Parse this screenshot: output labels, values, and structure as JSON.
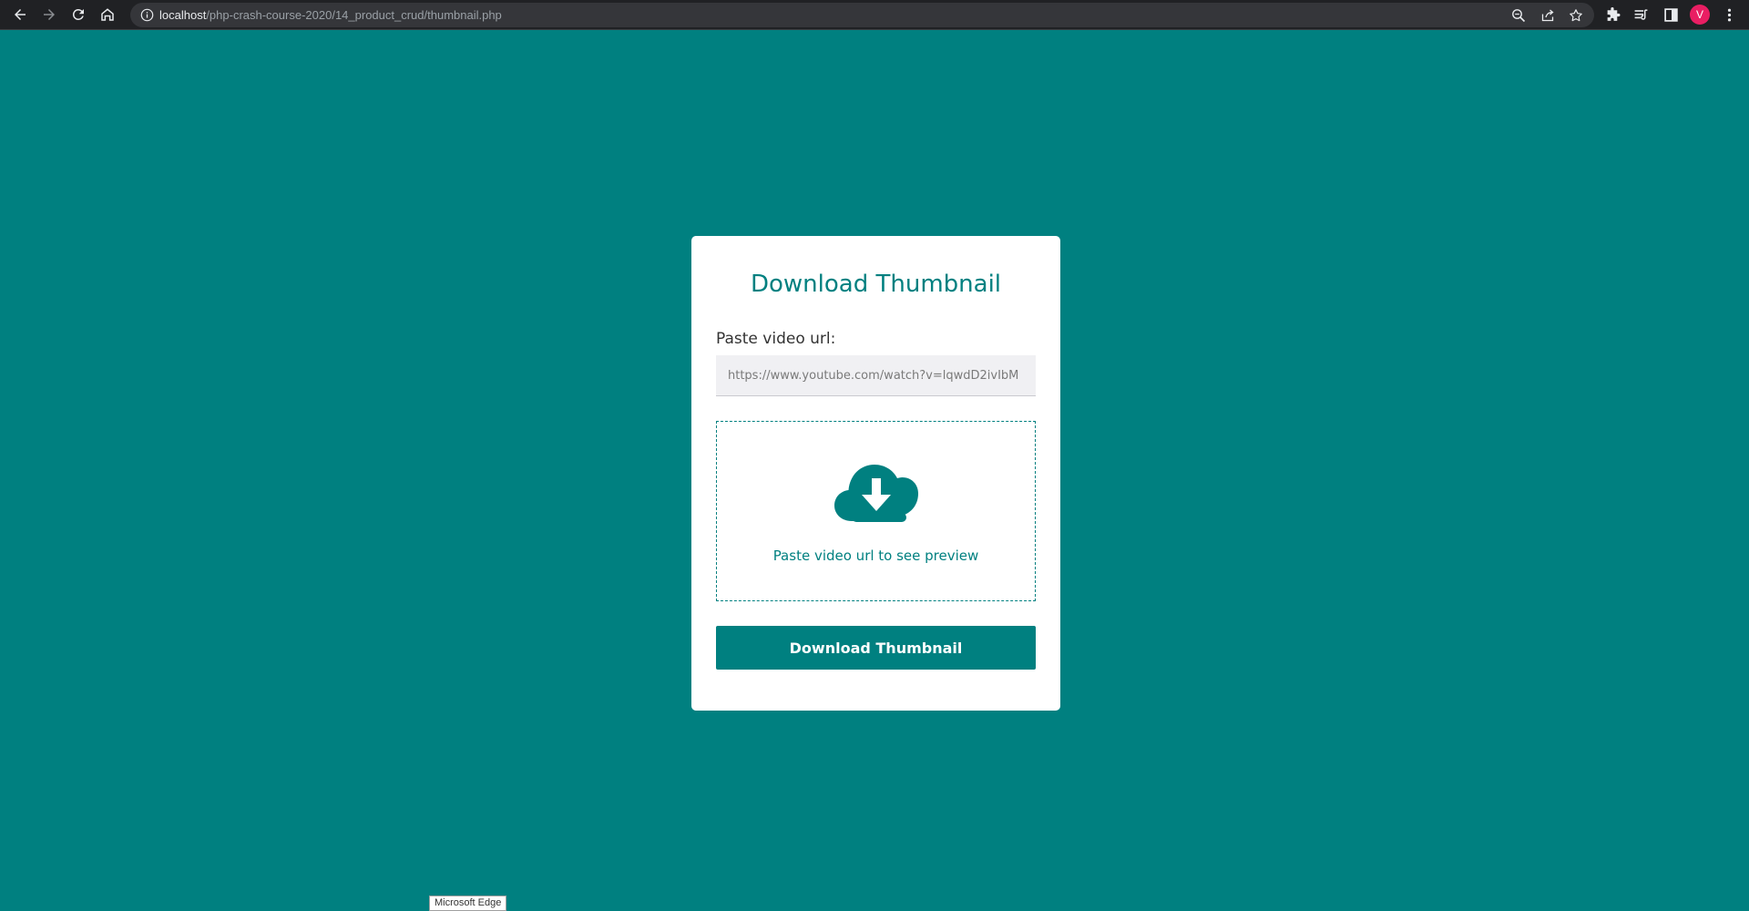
{
  "browser": {
    "url_host": "localhost",
    "url_path": "/php-crash-course-2020/14_product_crud/thumbnail.php",
    "profile_initial": "V",
    "avatar_color": "#e91e63"
  },
  "page": {
    "background_color": "#008080",
    "accent_color": "#008080"
  },
  "card": {
    "title": "Download Thumbnail",
    "input_label": "Paste video url:",
    "input_placeholder": "https://www.youtube.com/watch?v=lqwdD2ivIbM",
    "input_value": "",
    "preview_icon": "cloud-download-icon",
    "preview_text": "Paste video url to see preview",
    "button_label": "Download Thumbnail"
  },
  "tooltip": {
    "text": "Microsoft Edge"
  }
}
